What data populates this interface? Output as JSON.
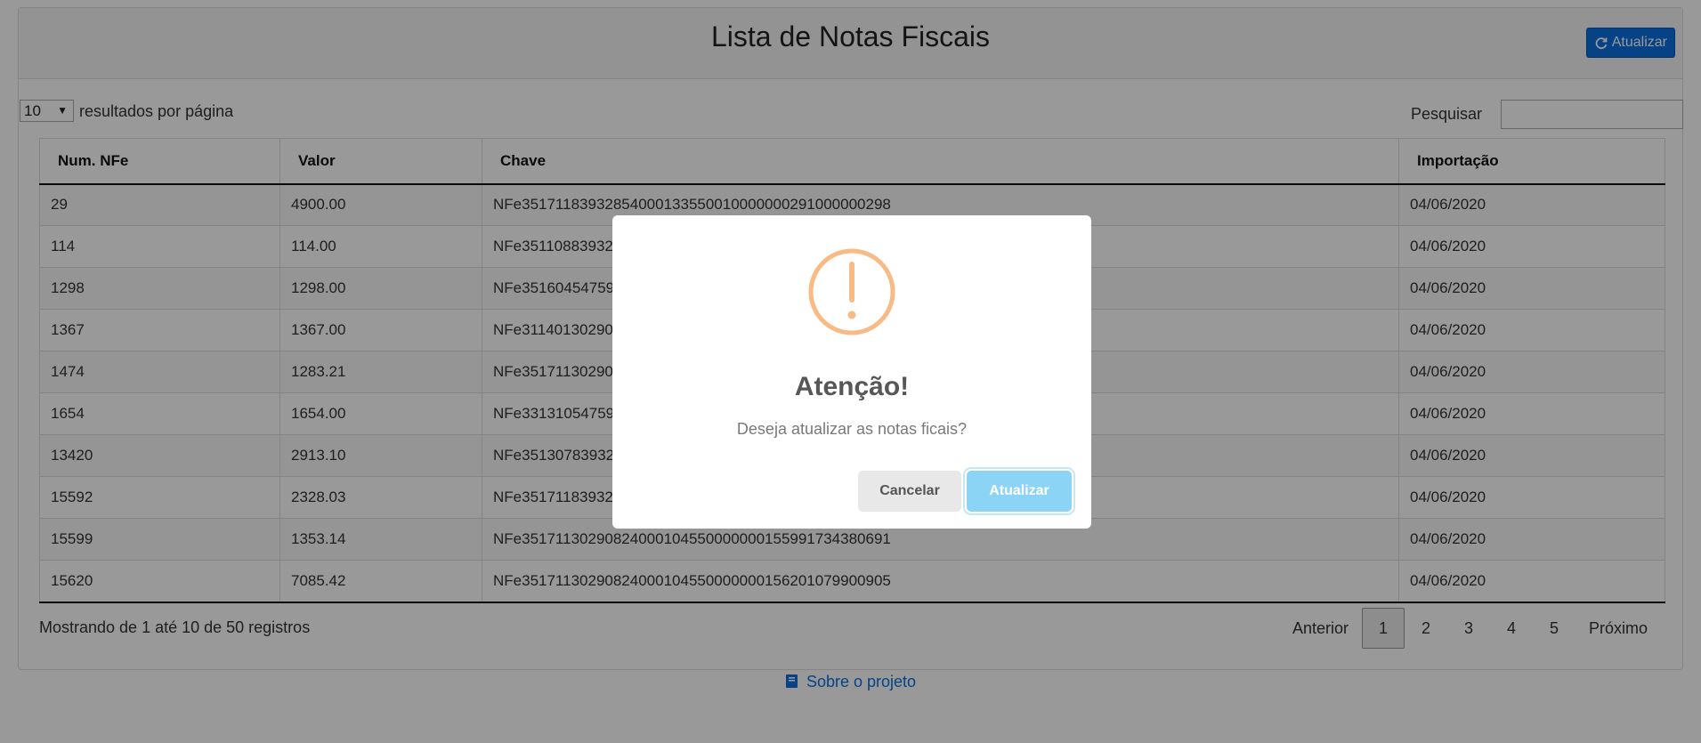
{
  "header": {
    "title": "Lista de Notas Fiscais",
    "refresh_label": "Atualizar",
    "refresh_icon": "refresh-icon"
  },
  "controls": {
    "page_length": "10",
    "page_length_label": "resultados por página",
    "search_label": "Pesquisar",
    "search_value": ""
  },
  "table": {
    "columns": [
      "Num. NFe",
      "Valor",
      "Chave",
      "Importação"
    ],
    "rows": [
      {
        "num": "29",
        "valor": "4900.00",
        "chave": "NFe35171183932854000133550010000000291000000298",
        "importacao": "04/06/2020"
      },
      {
        "num": "114",
        "valor": "114.00",
        "chave": "NFe35110883932",
        "importacao": "04/06/2020"
      },
      {
        "num": "1298",
        "valor": "1298.00",
        "chave": "NFe35160454759",
        "importacao": "04/06/2020"
      },
      {
        "num": "1367",
        "valor": "1367.00",
        "chave": "NFe31140130290",
        "importacao": "04/06/2020"
      },
      {
        "num": "1474",
        "valor": "1283.21",
        "chave": "NFe35171130290",
        "importacao": "04/06/2020"
      },
      {
        "num": "1654",
        "valor": "1654.00",
        "chave": "NFe33131054759",
        "importacao": "04/06/2020"
      },
      {
        "num": "13420",
        "valor": "2913.10",
        "chave": "NFe35130783932",
        "importacao": "04/06/2020"
      },
      {
        "num": "15592",
        "valor": "2328.03",
        "chave": "NFe35171183932",
        "importacao": "04/06/2020"
      },
      {
        "num": "15599",
        "valor": "1353.14",
        "chave": "NFe35171130290824000104550000000155991734380691",
        "importacao": "04/06/2020"
      },
      {
        "num": "15620",
        "valor": "7085.42",
        "chave": "NFe35171130290824000104550000000156201079900905",
        "importacao": "04/06/2020"
      }
    ]
  },
  "footer": {
    "info": "Mostrando de 1 até 10 de 50 registros",
    "previous": "Anterior",
    "next": "Próximo",
    "pages": [
      "1",
      "2",
      "3",
      "4",
      "5"
    ],
    "current_page": "1",
    "about_label": "Sobre o projeto",
    "about_icon": "book-icon"
  },
  "modal": {
    "icon": "warning-icon",
    "title": "Atenção!",
    "text": "Deseja atualizar as notas ficais?",
    "cancel_label": "Cancelar",
    "confirm_label": "Atualizar"
  },
  "colors": {
    "primary": "#0a6ee0",
    "warning": "#f8bb86",
    "confirm": "#8cd4f5",
    "overlay": "rgba(0,0,0,0.4)"
  }
}
